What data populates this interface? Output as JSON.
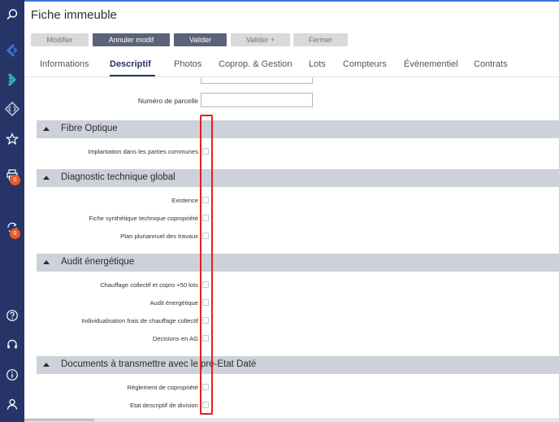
{
  "sidebar": {
    "icons": [
      "search-icon",
      "diamond-arrow-icon",
      "chevron-right-icon",
      "code-diamond-icon",
      "star-icon",
      "print-icon",
      "sync-icon",
      "help-icon",
      "headset-icon",
      "info-icon",
      "user-icon"
    ],
    "badges": {
      "print": "0",
      "sync": "0"
    },
    "colors": {
      "background": "#263468",
      "badge": "#f15a24",
      "accent_blue": "#3d74d9",
      "accent_teal": "#2fb4a9"
    }
  },
  "window": {
    "title": "Fiche immeuble"
  },
  "toolbar": {
    "modifier": "Modifier",
    "annuler": "Annuler modif",
    "valider": "Valider",
    "valider_plus": "Valider +",
    "fermer": "Fermer"
  },
  "tabs": [
    "Informations",
    "Descriptif",
    "Photos",
    "Coprop. & Gestion",
    "Lots",
    "Compteurs",
    "Évènementiel",
    "Contrats"
  ],
  "active_tab": "Descriptif",
  "fields": {
    "numero_parcelle": {
      "label": "Numéro de parcelle",
      "value": ""
    }
  },
  "sections": [
    {
      "title": "Fibre Optique",
      "items": [
        {
          "label": "Implantation dans les parties communes",
          "checked": false
        }
      ]
    },
    {
      "title": "Diagnostic technique global",
      "items": [
        {
          "label": "Existence",
          "checked": false
        },
        {
          "label": "Fiche synthétique technique copropriété",
          "checked": false
        },
        {
          "label": "Plan pluriannuel des travaux",
          "checked": false
        }
      ]
    },
    {
      "title": "Audit énergétique",
      "items": [
        {
          "label": "Chauffage collectif et copro +50 lots",
          "checked": false
        },
        {
          "label": "Audit énergétique",
          "checked": false
        },
        {
          "label": "Individualisation frais de chauffage collectif",
          "checked": false
        },
        {
          "label": "Decisions en AG",
          "checked": false
        }
      ]
    },
    {
      "title": "Documents à transmettre avec le pré-Etat Daté",
      "items": [
        {
          "label": "Règlement de copropriété",
          "checked": false
        },
        {
          "label": "Etat descriptif de division",
          "checked": false
        }
      ]
    }
  ],
  "colors": {
    "highlight": "#e02020",
    "section_bg": "#cdd1d9",
    "active_tab": "#263468"
  }
}
